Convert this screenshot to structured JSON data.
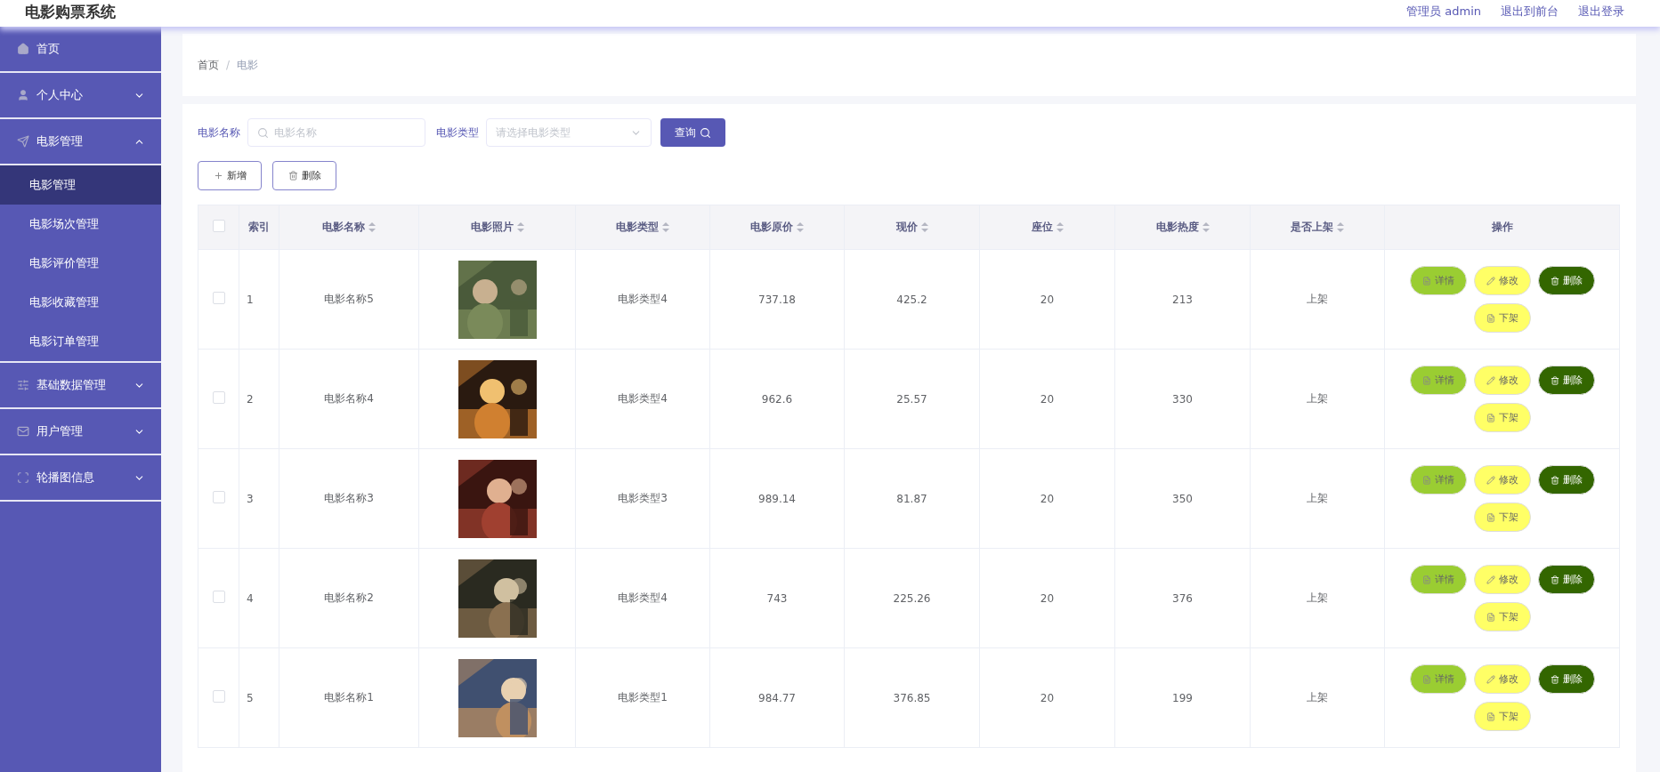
{
  "header": {
    "title": "电影购票系统",
    "links": [
      "管理员 admin",
      "退出到前台",
      "退出登录"
    ]
  },
  "sidebar": {
    "items": [
      {
        "label": "首页"
      },
      {
        "label": "个人中心",
        "expanded": false
      },
      {
        "label": "电影管理",
        "expanded": true,
        "children": [
          {
            "label": "电影管理",
            "selected": true
          },
          {
            "label": "电影场次管理",
            "selected": false
          },
          {
            "label": "电影评价管理",
            "selected": false
          },
          {
            "label": "电影收藏管理",
            "selected": false
          },
          {
            "label": "电影订单管理",
            "selected": false
          }
        ]
      },
      {
        "label": "基础数据管理",
        "expanded": false
      },
      {
        "label": "用户管理",
        "expanded": false
      },
      {
        "label": "轮播图信息",
        "expanded": false
      }
    ]
  },
  "breadcrumb": {
    "items": [
      "首页",
      "电影"
    ],
    "separator": "/"
  },
  "search": {
    "fields": [
      {
        "kind": "text",
        "label": "电影名称",
        "placeholder": "电影名称"
      },
      {
        "kind": "select",
        "label": "电影类型",
        "placeholder": "请选择电影类型"
      }
    ],
    "button": "查询"
  },
  "toolbar": [
    "新增",
    "删除"
  ],
  "table": {
    "all_checked": false,
    "columns": [
      {
        "label": "索引",
        "sortable": false
      },
      {
        "label": "电影名称",
        "sortable": true
      },
      {
        "label": "电影照片",
        "sortable": true
      },
      {
        "label": "电影类型",
        "sortable": true
      },
      {
        "label": "电影原价",
        "sortable": true
      },
      {
        "label": "现价",
        "sortable": true
      },
      {
        "label": "座位",
        "sortable": true
      },
      {
        "label": "电影热度",
        "sortable": true
      },
      {
        "label": "是否上架",
        "sortable": true
      },
      {
        "label": "操作",
        "sortable": false
      }
    ],
    "rows": [
      {
        "checked": false,
        "index": "1",
        "name": "电影名称5",
        "photo": {
          "kind": "picture"
        },
        "type": "电影类型4",
        "original_price": "737.18",
        "price": "425.2",
        "seats": "20",
        "popularity": "213",
        "status": "上架",
        "actions": [
          {
            "label": "详情",
            "color": "#9acd32"
          },
          {
            "label": "修改",
            "color": "#ffff66"
          },
          {
            "label": "删除",
            "color": "#336600"
          },
          {
            "label": "下架",
            "color": "#ffff66"
          }
        ]
      },
      {
        "checked": false,
        "index": "2",
        "name": "电影名称4",
        "photo": {
          "kind": "picture"
        },
        "type": "电影类型4",
        "original_price": "962.6",
        "price": "25.57",
        "seats": "20",
        "popularity": "330",
        "status": "上架",
        "actions": [
          {
            "label": "详情",
            "color": "#9acd32"
          },
          {
            "label": "修改",
            "color": "#ffff66"
          },
          {
            "label": "删除",
            "color": "#336600"
          },
          {
            "label": "下架",
            "color": "#ffff66"
          }
        ]
      },
      {
        "checked": false,
        "index": "3",
        "name": "电影名称3",
        "photo": {
          "kind": "picture"
        },
        "type": "电影类型3",
        "original_price": "989.14",
        "price": "81.87",
        "seats": "20",
        "popularity": "350",
        "status": "上架",
        "actions": [
          {
            "label": "详情",
            "color": "#9acd32"
          },
          {
            "label": "修改",
            "color": "#ffff66"
          },
          {
            "label": "删除",
            "color": "#336600"
          },
          {
            "label": "下架",
            "color": "#ffff66"
          }
        ]
      },
      {
        "checked": false,
        "index": "4",
        "name": "电影名称2",
        "photo": {
          "kind": "picture"
        },
        "type": "电影类型4",
        "original_price": "743",
        "price": "225.26",
        "seats": "20",
        "popularity": "376",
        "status": "上架",
        "actions": [
          {
            "label": "详情",
            "color": "#9acd32"
          },
          {
            "label": "修改",
            "color": "#ffff66"
          },
          {
            "label": "删除",
            "color": "#336600"
          },
          {
            "label": "下架",
            "color": "#ffff66"
          }
        ]
      },
      {
        "checked": false,
        "index": "5",
        "name": "电影名称1",
        "photo": {
          "kind": "picture"
        },
        "type": "电影类型1",
        "original_price": "984.77",
        "price": "376.85",
        "seats": "20",
        "popularity": "199",
        "status": "上架",
        "actions": [
          {
            "label": "详情",
            "color": "#9acd32"
          },
          {
            "label": "修改",
            "color": "#ffff66"
          },
          {
            "label": "删除",
            "color": "#336600"
          },
          {
            "label": "下架",
            "color": "#ffff66"
          }
        ]
      }
    ]
  }
}
